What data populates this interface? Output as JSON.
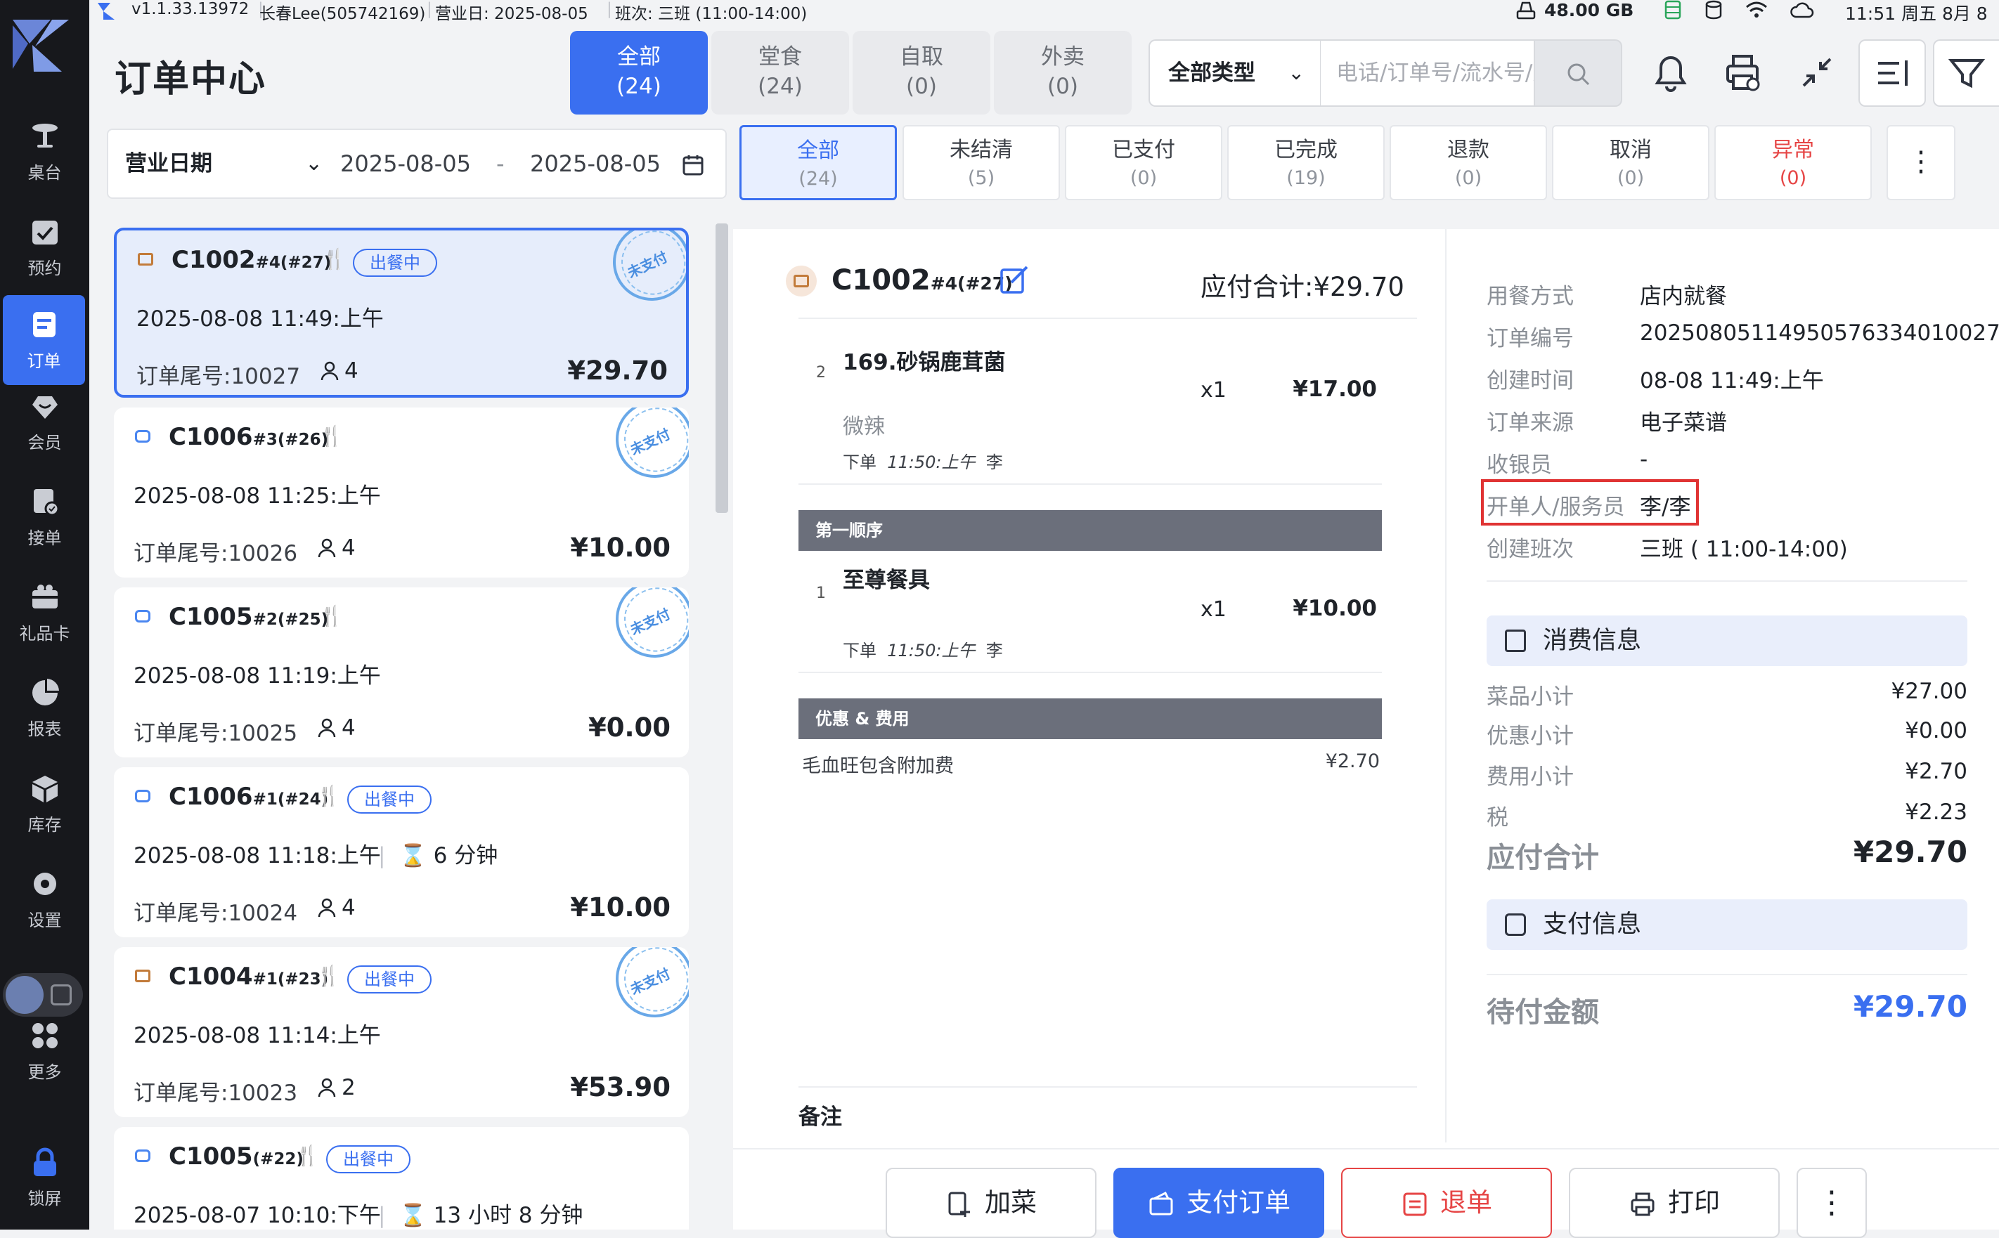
{
  "status_bar": {
    "version": "v1.1.33.13972",
    "user": "长春Lee(505742169)",
    "business_day": "营业日: 2025-08-05",
    "shift": "班次: 三班 (11:00-14:00)",
    "storage": "48.00 GB",
    "clock": "11:51 周五 8月 8"
  },
  "nav": {
    "items": [
      {
        "label": "桌台",
        "icon": "table-icon"
      },
      {
        "label": "预约",
        "icon": "calendar-check-icon"
      },
      {
        "label": "订单",
        "icon": "order-icon"
      },
      {
        "label": "会员",
        "icon": "member-icon"
      },
      {
        "label": "接单",
        "icon": "accept-order-icon"
      },
      {
        "label": "礼品卡",
        "icon": "gift-card-icon"
      },
      {
        "label": "报表",
        "icon": "report-icon"
      },
      {
        "label": "库存",
        "icon": "inventory-icon"
      },
      {
        "label": "设置",
        "icon": "settings-icon"
      },
      {
        "label": "更多",
        "icon": "more-apps-icon"
      },
      {
        "label": "锁屏",
        "icon": "lock-icon"
      }
    ],
    "active": "订单"
  },
  "header": {
    "title": "订单中心",
    "order_types": [
      {
        "label": "全部",
        "count": "(24)"
      },
      {
        "label": "堂食",
        "count": "(24)"
      },
      {
        "label": "自取",
        "count": "(0)"
      },
      {
        "label": "外卖",
        "count": "(0)"
      }
    ],
    "type_select": "全部类型",
    "search_placeholder": "电话/订单号/流水号/桌"
  },
  "filter": {
    "date_label": "营业日期",
    "date_from": "2025-08-05",
    "date_sep": "-",
    "date_to": "2025-08-05",
    "status_tabs": [
      {
        "label": "全部",
        "count": "(24)"
      },
      {
        "label": "未结清",
        "count": "(5)"
      },
      {
        "label": "已支付",
        "count": "(0)"
      },
      {
        "label": "已完成",
        "count": "(19)"
      },
      {
        "label": "退款",
        "count": "(0)"
      },
      {
        "label": "取消",
        "count": "(0)"
      },
      {
        "label": "异常",
        "count": "(0)"
      }
    ]
  },
  "orders": [
    {
      "code": "C1002",
      "sub": "#4(#27)",
      "state": "出餐中",
      "time": "2025-08-08 11:49:上午",
      "tail": "订单尾号:10027",
      "guests": "4",
      "amount": "¥29.70",
      "unpaid": "未支付"
    },
    {
      "code": "C1006",
      "sub": "#3(#26)",
      "state": "",
      "time": "2025-08-08 11:25:上午",
      "tail": "订单尾号:10026",
      "guests": "4",
      "amount": "¥10.00",
      "unpaid": "未支付"
    },
    {
      "code": "C1005",
      "sub": "#2(#25)",
      "state": "",
      "time": "2025-08-08 11:19:上午",
      "tail": "订单尾号:10025",
      "guests": "4",
      "amount": "¥0.00",
      "unpaid": "未支付"
    },
    {
      "code": "C1006",
      "sub": "#1(#24)",
      "state": "出餐中",
      "time": "2025-08-08 11:18:上午",
      "wait": "6 分钟",
      "tail": "订单尾号:10024",
      "guests": "4",
      "amount": "¥10.00",
      "unpaid": ""
    },
    {
      "code": "C1004",
      "sub": "#1(#23)",
      "state": "出餐中",
      "time": "2025-08-08 11:14:上午",
      "tail": "订单尾号:10023",
      "guests": "2",
      "amount": "¥53.90",
      "unpaid": "未支付"
    },
    {
      "code": "C1005",
      "sub": "(#22)",
      "state": "出餐中",
      "time": "2025-08-07 10:10:下午",
      "wait": "13 小时 8 分钟",
      "tail": "",
      "guests": "",
      "amount": "",
      "unpaid": ""
    }
  ],
  "detail": {
    "code": "C1002",
    "sub": "#4(#27)",
    "total_label": "应付合计:¥29.70",
    "items": [
      {
        "index": "2",
        "name": "169.砂锅鹿茸菌",
        "qty": "x1",
        "price": "¥17.00",
        "note": "微辣",
        "meta_prefix": "下单",
        "meta_time": "11:50:上午",
        "meta_by": "李"
      },
      {
        "index": "1",
        "name": "至尊餐具",
        "qty": "x1",
        "price": "¥10.00",
        "note": "",
        "meta_prefix": "下单",
        "meta_time": "11:50:上午",
        "meta_by": "李"
      }
    ],
    "section_first": "第一顺序",
    "section_fees": "优惠 & 费用",
    "fee": {
      "label": "毛血旺包含附加费",
      "value": "¥2.70"
    },
    "remark_label": "备注",
    "info": [
      {
        "k": "用餐方式",
        "v": "店内就餐"
      },
      {
        "k": "订单编号",
        "v": "20250805114950576334010027"
      },
      {
        "k": "创建时间",
        "v": "08-08 11:49:上午"
      },
      {
        "k": "订单来源",
        "v": "电子菜谱"
      },
      {
        "k": "收银员",
        "v": "-"
      },
      {
        "k": "开单人/服务员",
        "v": "李/李"
      },
      {
        "k": "创建班次",
        "v": "三班 ( 11:00-14:00)"
      }
    ],
    "consume_title": "消费信息",
    "sums": [
      {
        "k": "菜品小计",
        "v": "¥27.00"
      },
      {
        "k": "优惠小计",
        "v": "¥0.00"
      },
      {
        "k": "费用小计",
        "v": "¥2.70"
      },
      {
        "k": "税",
        "v": "¥2.23"
      }
    ],
    "total": {
      "k": "应付合计",
      "v": "¥29.70"
    },
    "payment_title": "支付信息",
    "due": {
      "k": "待付金额",
      "v": "¥29.70"
    }
  },
  "actions": {
    "add": "加菜",
    "pay": "支付订单",
    "refund": "退单",
    "print": "打印"
  },
  "colors": {
    "accent": "#3a6ff0",
    "danger": "#e64545",
    "nav_bg": "#17181c"
  }
}
